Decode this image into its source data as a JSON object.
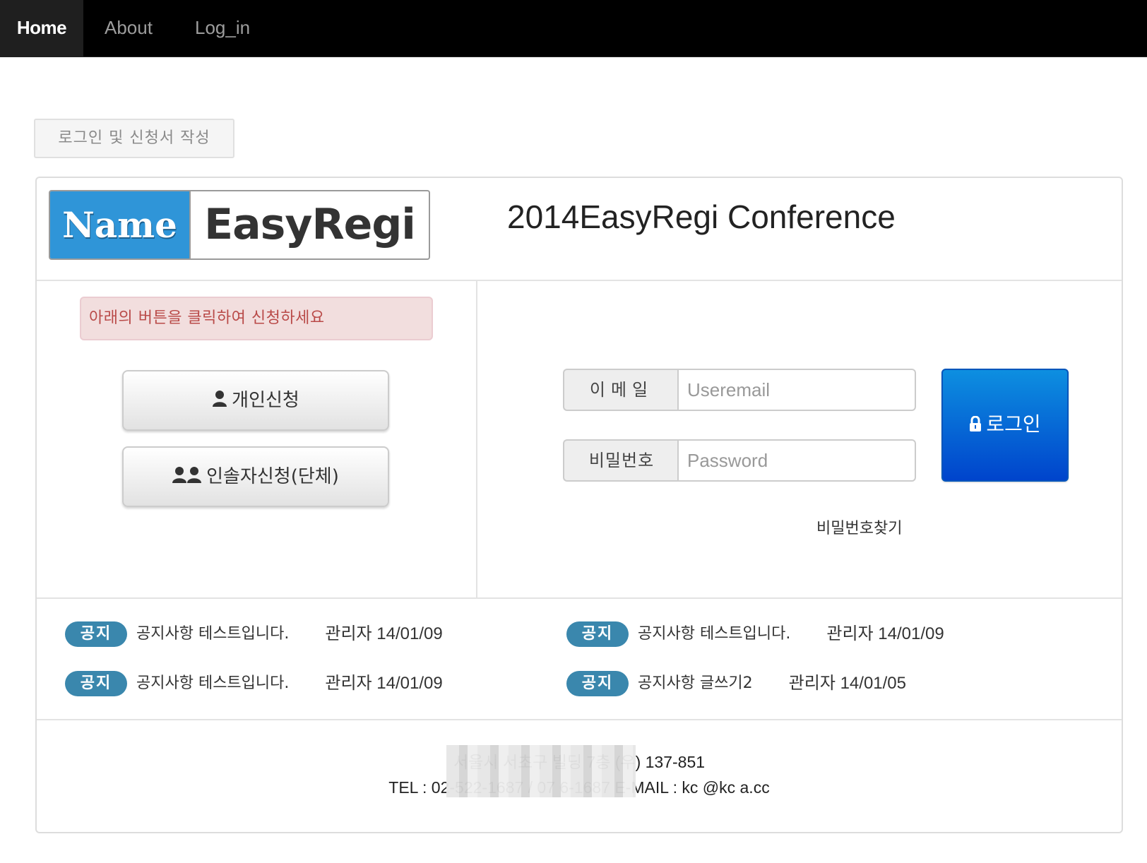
{
  "nav": {
    "home": "Home",
    "about": "About",
    "login": "Log_in"
  },
  "section_label": "로그인 및 신청서 작성",
  "logo": {
    "left_text": "Name",
    "right_text": "EasyRegi",
    "colors": {
      "accent": "#2f95d8"
    }
  },
  "conference_title": "2014EasyRegi Conference",
  "alert_text": "아래의 버튼을 클릭하여 신청하세요",
  "buttons": {
    "personal": "개인신청",
    "group": "인솔자신청(단체)",
    "personal_icon": "user-icon",
    "group_icon": "users-icon"
  },
  "login": {
    "email_label": "이메일",
    "email_placeholder": "Useremail",
    "password_label": "비밀번호",
    "password_placeholder": "Password",
    "button_label": "로그인",
    "button_icon": "lock-icon",
    "forgot": "비밀번호찾기",
    "colors": {
      "button": "#0066dd"
    }
  },
  "notices": [
    {
      "badge": "공지",
      "title": "공지사항 테스트입니다.",
      "meta": "관리자 14/01/09"
    },
    {
      "badge": "공지",
      "title": "공지사항 테스트입니다.",
      "meta": "관리자 14/01/09"
    },
    {
      "badge": "공지",
      "title": "공지사항 테스트입니다.",
      "meta": "관리자 14/01/09"
    },
    {
      "badge": "공지",
      "title": "공지사항 글쓰기2",
      "meta": "관리자 14/01/05"
    }
  ],
  "footer": {
    "address": "서울시 서초구 빌딩 7층 (우) 137-851",
    "contact": "TEL : 02-522-1687 / 07 6-1687 E-MAIL : kc @kc a.cc"
  }
}
